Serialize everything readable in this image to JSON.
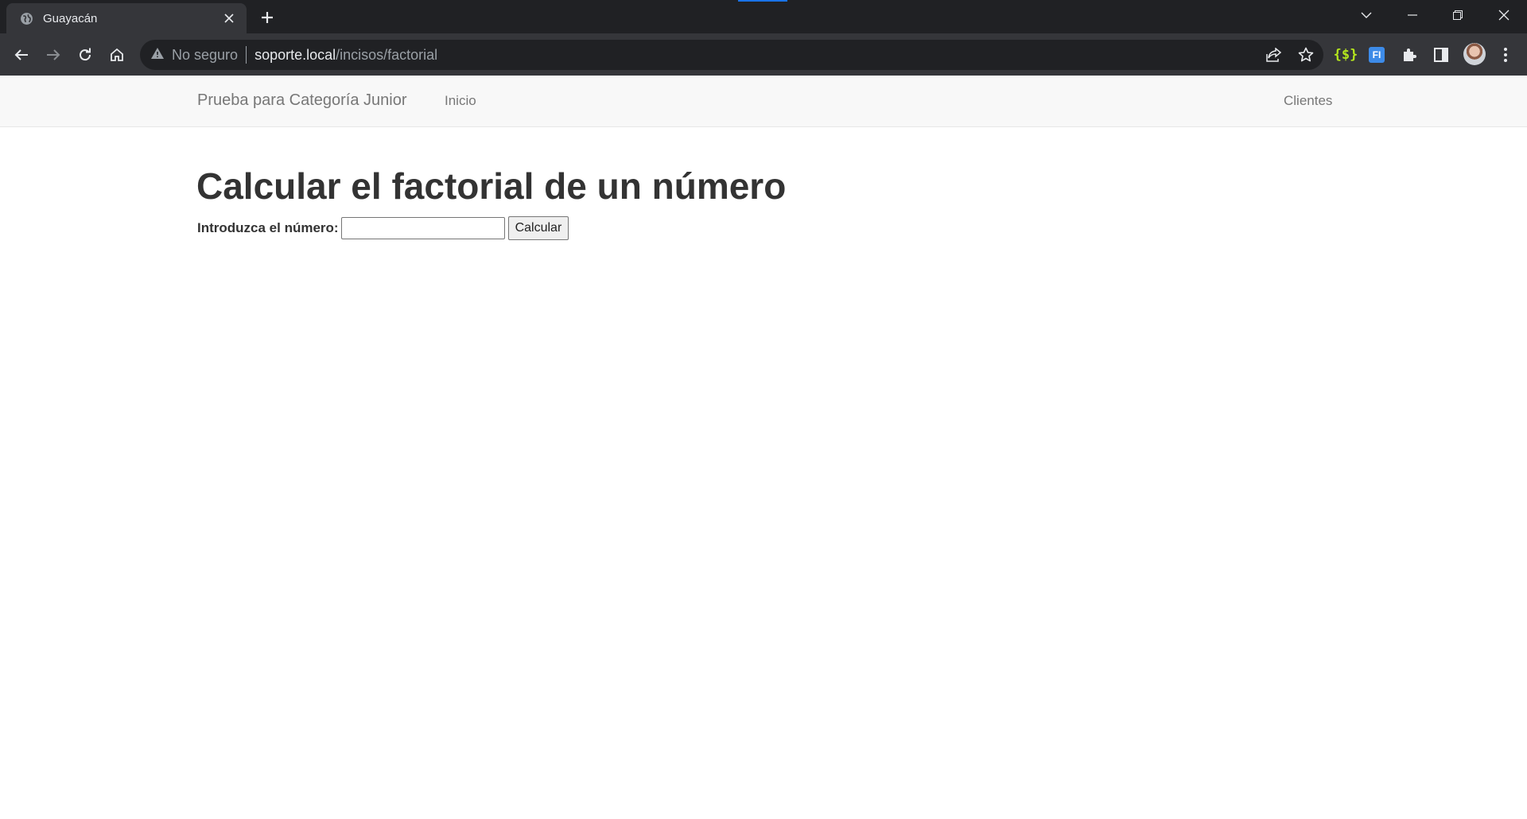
{
  "browser": {
    "tab_title": "Guayacán",
    "security_label": "No seguro",
    "url_host": "soporte.local",
    "url_path": "/incisos/factorial",
    "extension_fi_label": "FI"
  },
  "navbar": {
    "brand": "Prueba para Categoría Junior",
    "links": [
      "Inicio",
      "Clientes"
    ]
  },
  "main": {
    "title": "Calcular el factorial de un número",
    "input_label": "Introduzca el número:",
    "input_value": "",
    "button_label": "Calcular"
  }
}
